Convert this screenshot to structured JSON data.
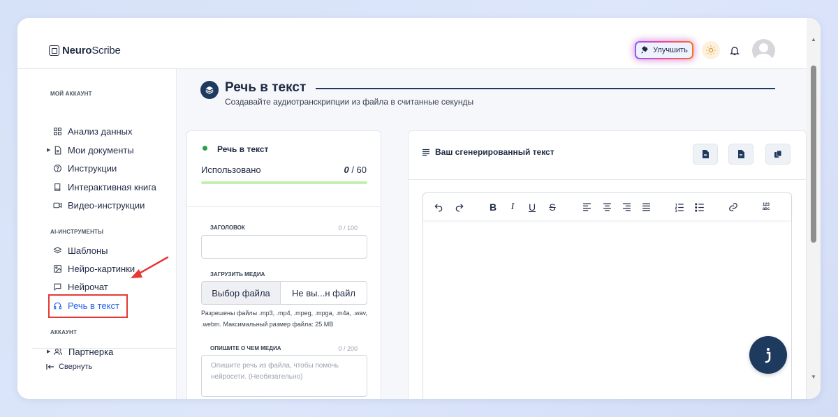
{
  "app": {
    "logo_bold": "Neuro",
    "logo_regular": "Scribe"
  },
  "header": {
    "upgrade_label": "Улучшить"
  },
  "sidebar": {
    "section_account": "МОЙ АККАУНТ",
    "section_ai": "AI-ИНСТРУМЕНТЫ",
    "section_profile": "АККАУНТ",
    "items": [
      {
        "label": "Анализ данных",
        "icon": "grid-icon"
      },
      {
        "label": "Мои документы",
        "icon": "document-icon"
      },
      {
        "label": "Инструкции",
        "icon": "question-icon"
      },
      {
        "label": "Интерактивная книга",
        "icon": "book-icon"
      },
      {
        "label": "Видео-инструкции",
        "icon": "video-icon"
      },
      {
        "label": "Шаблоны",
        "icon": "layers-icon"
      },
      {
        "label": "Нейро-картинки",
        "icon": "image-icon"
      },
      {
        "label": "Нейрочат",
        "icon": "chat-icon"
      },
      {
        "label": "Речь в текст",
        "icon": "headphones-icon",
        "active": true
      },
      {
        "label": "Партнерка",
        "icon": "users-icon"
      }
    ],
    "collapse_label": "Свернуть"
  },
  "page": {
    "title": "Речь в текст",
    "subtitle": "Создавайте аудиотранскрипции из файла в считанные секунды"
  },
  "form": {
    "title": "Речь в текст",
    "used_label": "Использовано",
    "used_value": "0",
    "used_total": "/ 60",
    "usage_fraction": 0.0,
    "heading_label": "ЗАГОЛОВОК",
    "heading_count": "0 / 100",
    "heading_value": "",
    "upload_label": "ЗАГРУЗИТЬ МЕДИА",
    "choose_file": "Выбор файла",
    "file_name": "Не вы...н файл",
    "hint": "Разрешены файлы .mp3, .mp4, .mpeg, .mpga, .m4a, .wav, .webm. Максимальный размер файла: 25 MB",
    "describe_label": "ОПИШИТЕ О ЧЕМ МЕДИА",
    "describe_count": "0 / 200",
    "describe_placeholder": "Опишите речь из файла, чтобы помочь нейросети. (Необязательно)"
  },
  "output": {
    "title": "Ваш сгенерированный текст",
    "actions": [
      "word-doc-icon",
      "pdf-doc-icon",
      "copy-icon"
    ],
    "toolbar": [
      "undo-icon",
      "redo-icon",
      "bold-icon",
      "italic-icon",
      "underline-icon",
      "strikethrough-icon",
      "align-left-icon",
      "align-center-icon",
      "align-right-icon",
      "align-justify-icon",
      "ordered-list-icon",
      "bullet-list-icon",
      "link-icon",
      "spellcheck-icon"
    ],
    "spellcheck_top": "123",
    "spellcheck_bottom": "abc"
  },
  "colors": {
    "brand_dark": "#1e3a5f",
    "active_blue": "#2563eb",
    "annotation_red": "#e53935",
    "status_green": "#22a34a"
  }
}
